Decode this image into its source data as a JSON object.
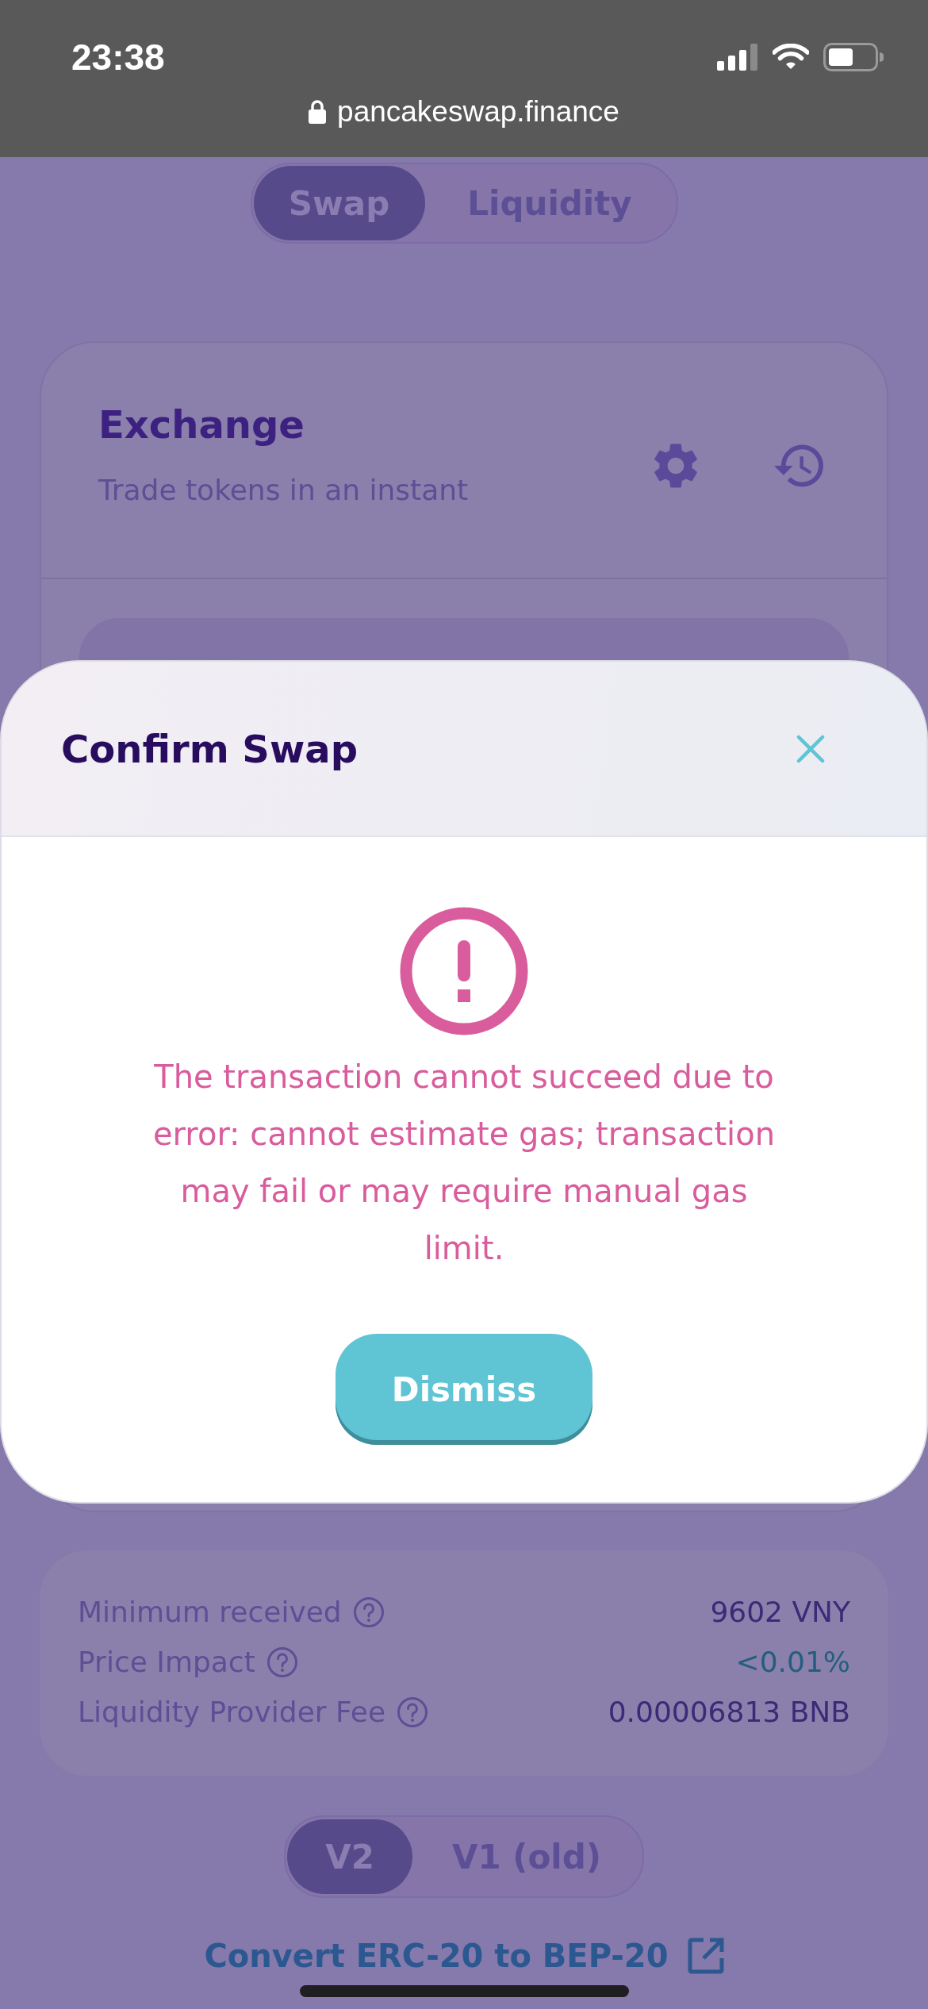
{
  "status_bar": {
    "time": "23:38",
    "url": "pancakeswap.finance"
  },
  "nav_tabs": [
    {
      "label": "Swap",
      "selected": true
    },
    {
      "label": "Liquidity",
      "selected": false
    }
  ],
  "exchange_card": {
    "title": "Exchange",
    "subtitle": "Trade tokens in an instant"
  },
  "modal": {
    "title": "Confirm Swap",
    "message": "The transaction cannot succeed due to error: cannot estimate gas; transaction may fail or may require manual gas limit.",
    "button": "Dismiss"
  },
  "details": [
    {
      "label": "Minimum received",
      "value": "9602 VNY",
      "color": "#3a2a78"
    },
    {
      "label": "Price Impact",
      "value": "<0.01%",
      "color": "#245e7e"
    },
    {
      "label": "Liquidity Provider Fee",
      "value": "0.00006813 BNB",
      "color": "#3a2a78"
    }
  ],
  "version_tabs": [
    {
      "label": "V2",
      "selected": true
    },
    {
      "label": "V1 (old)",
      "selected": false
    }
  ],
  "bridge_link": {
    "label": "Convert ERC-20 to BEP-20"
  }
}
